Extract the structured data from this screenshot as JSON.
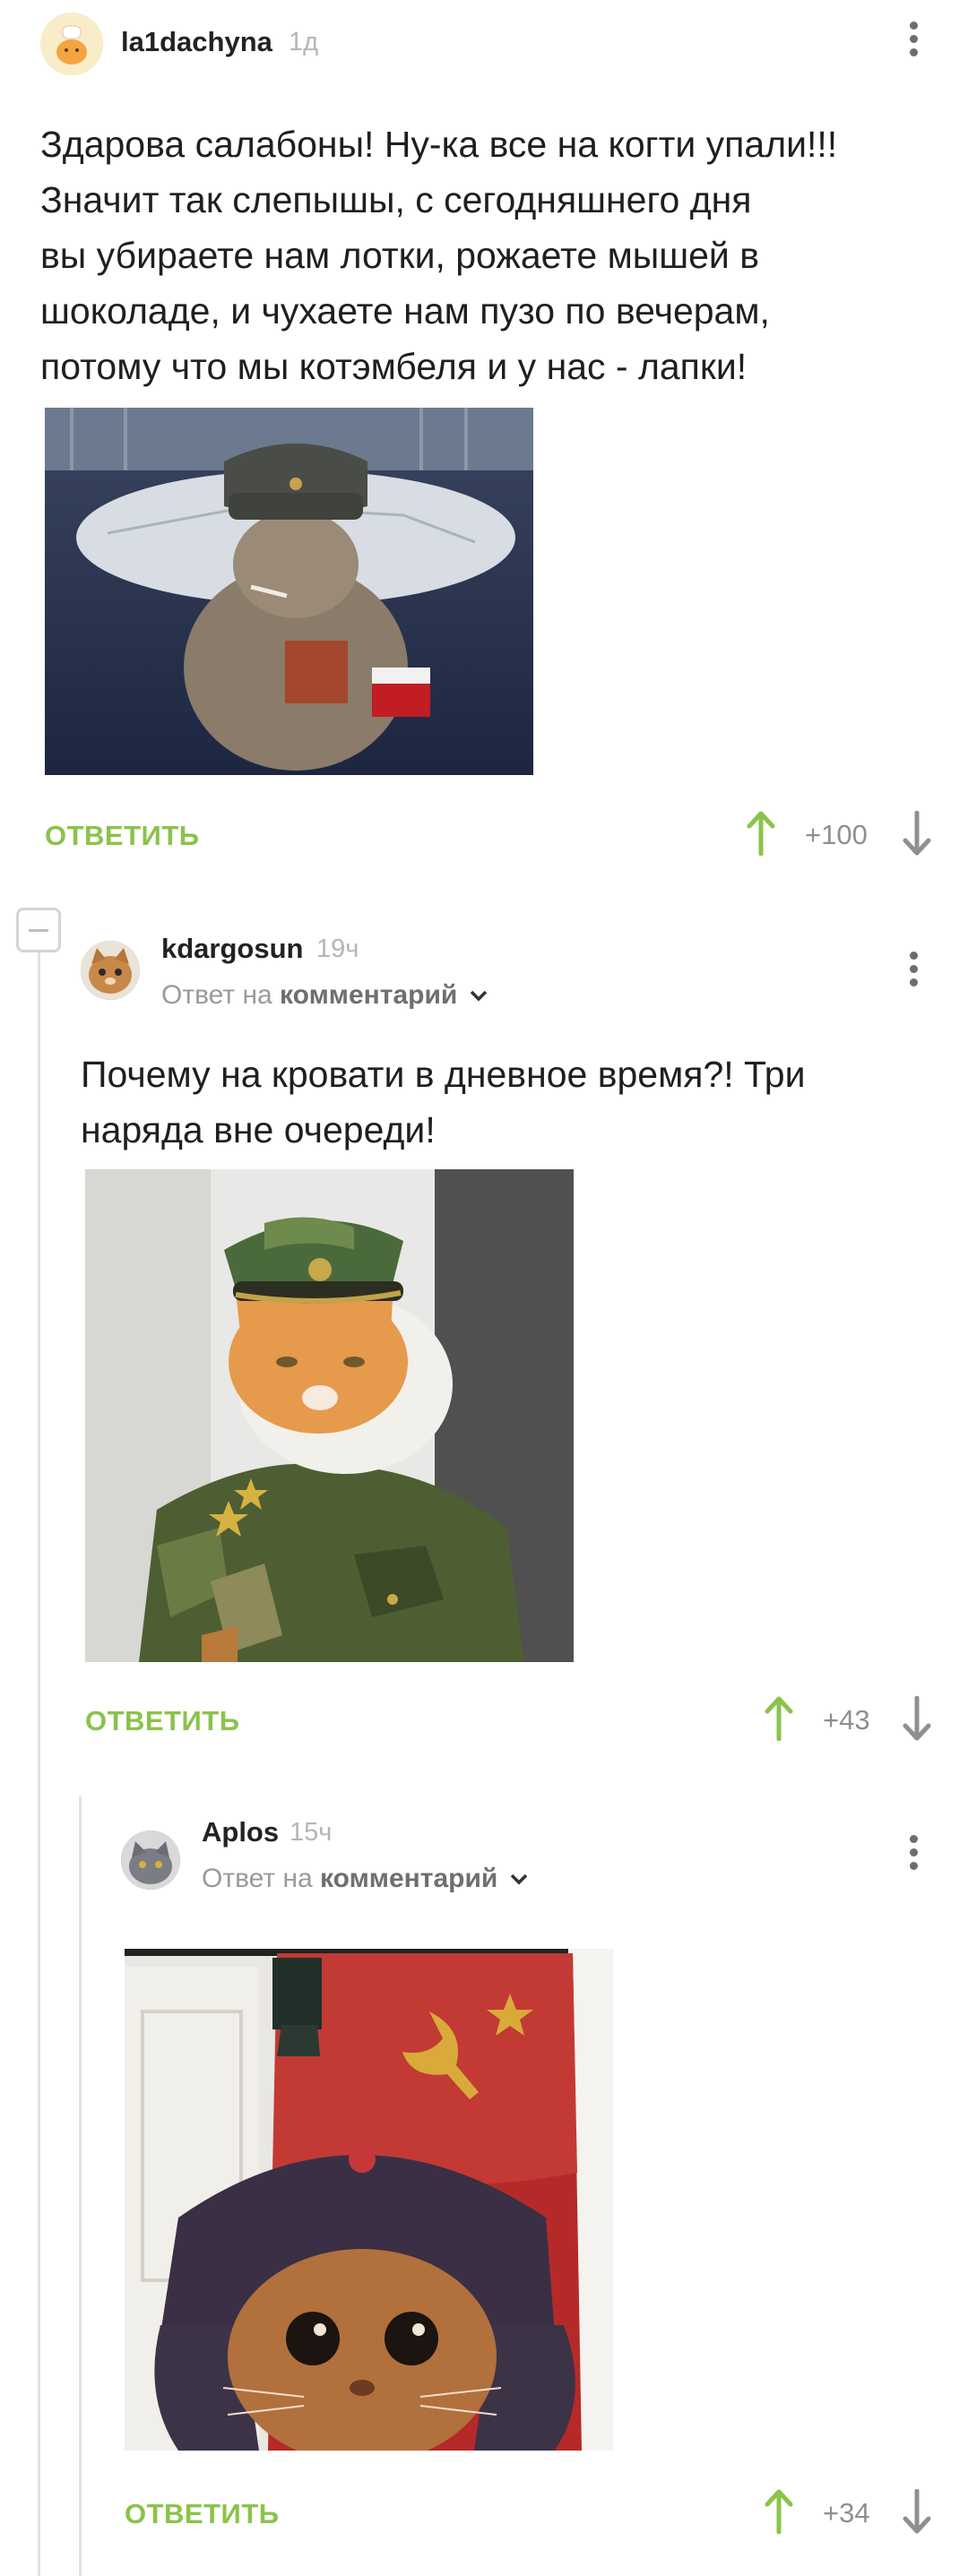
{
  "comments": [
    {
      "username": "la1dachyna",
      "time": "1д",
      "text_lines": [
        "Здарова салабоны! Ну-ка все на когти упали!!!",
        "Значит так слепышы, с сегодняшнего дня",
        "вы убираете нам лотки, рожаете мышей в",
        "шоколаде, и чухаете нам пузо по вечерам,",
        "потому что мы котэмбеля и у нас - лапки!"
      ],
      "image_icon": "cat-in-ushanka-smoking-photo",
      "reply_label": "ОТВЕТИТЬ",
      "score": "+100"
    },
    {
      "username": "kdargosun",
      "time": "19ч",
      "reply_prefix": "Ответ на",
      "reply_target": "комментарий",
      "text_lines": [
        "Почему на кровати в дневное время?! Три",
        "наряда вне очереди!"
      ],
      "image_icon": "cat-in-military-uniform-photo",
      "reply_label": "ОТВЕТИТЬ",
      "score": "+43"
    },
    {
      "username": "Aplos",
      "time": "15ч",
      "reply_prefix": "Ответ на",
      "reply_target": "комментарий",
      "image_icon": "cat-ushanka-soviet-flag-photo",
      "reply_label": "ОТВЕТИТЬ",
      "score": "+34"
    }
  ],
  "colors": {
    "accent_green": "#8ac34a",
    "muted_gray": "#9a9a9a",
    "thread_line": "#e1e1e1"
  }
}
